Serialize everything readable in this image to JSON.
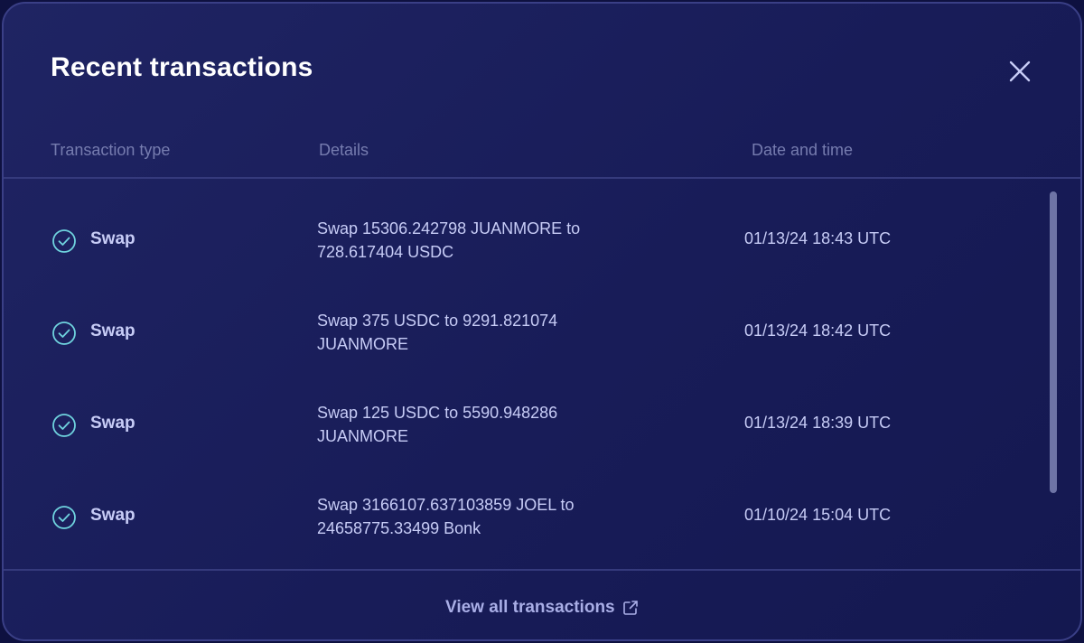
{
  "modal": {
    "title": "Recent transactions",
    "close_icon": "close-icon"
  },
  "table": {
    "headers": {
      "type": "Transaction type",
      "details": "Details",
      "date": "Date and time"
    },
    "rows": [
      {
        "status_icon": "check-circle-icon",
        "type": "Swap",
        "details_line1": "Swap 15306.242798 JUANMORE to",
        "details_line2": "728.617404 USDC",
        "datetime": "01/13/24 18:43 UTC"
      },
      {
        "status_icon": "check-circle-icon",
        "type": "Swap",
        "details_line1": "Swap 375 USDC to 9291.821074",
        "details_line2": "JUANMORE",
        "datetime": "01/13/24 18:42 UTC"
      },
      {
        "status_icon": "check-circle-icon",
        "type": "Swap",
        "details_line1": "Swap 125 USDC to 5590.948286",
        "details_line2": "JUANMORE",
        "datetime": "01/13/24 18:39 UTC"
      },
      {
        "status_icon": "check-circle-icon",
        "type": "Swap",
        "details_line1": "Swap 3166107.637103859 JOEL to",
        "details_line2": "24658775.33499 Bonk",
        "datetime": "01/10/24 15:04 UTC"
      }
    ]
  },
  "footer": {
    "view_all_label": "View all transactions",
    "external_icon": "external-link-icon"
  },
  "colors": {
    "background": "#1a1e5a",
    "border": "#3a3f86",
    "text_primary": "#c7ccf6",
    "text_muted": "#767caf",
    "success": "#6fd3de"
  }
}
